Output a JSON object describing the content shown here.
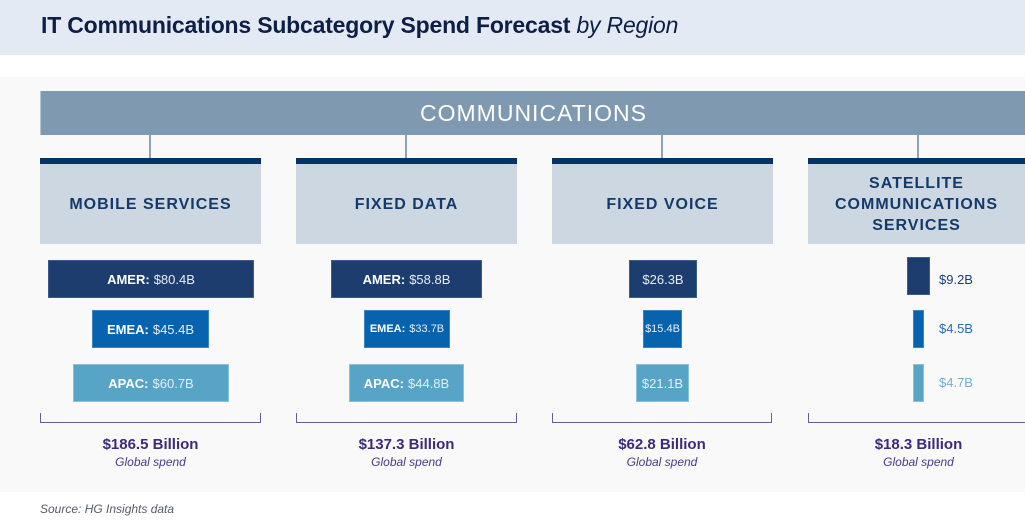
{
  "header": {
    "title_main": "IT Communications Subcategory Spend Forecast",
    "title_sub": "by Region"
  },
  "root": {
    "label": "COMMUNICATIONS"
  },
  "categories": [
    {
      "name": "MOBILE SERVICES",
      "regions": [
        {
          "region": "AMER:",
          "value": "$80.4B",
          "amount": 80.4
        },
        {
          "region": "EMEA:",
          "value": "$45.4B",
          "amount": 45.4
        },
        {
          "region": "APAC:",
          "value": "$60.7B",
          "amount": 60.7
        }
      ],
      "total": "$186.5 Billion",
      "total_label": "Global spend"
    },
    {
      "name": "FIXED DATA",
      "regions": [
        {
          "region": "AMER:",
          "value": "$58.8B",
          "amount": 58.8
        },
        {
          "region": "EMEA:",
          "value": "$33.7B",
          "amount": 33.7
        },
        {
          "region": "APAC:",
          "value": "$44.8B",
          "amount": 44.8
        }
      ],
      "total": "$137.3 Billion",
      "total_label": "Global spend"
    },
    {
      "name": "FIXED VOICE",
      "regions": [
        {
          "region": "",
          "value": "$26.3B",
          "amount": 26.3
        },
        {
          "region": "",
          "value": "$15.4B",
          "amount": 15.4
        },
        {
          "region": "",
          "value": "$21.1B",
          "amount": 21.1
        }
      ],
      "total": "$62.8 Billion",
      "total_label": "Global spend"
    },
    {
      "name": "SATELLITE COMMUNICATIONS SERVICES",
      "name_lines": [
        "SATELLITE",
        "COMMUNICATIONS",
        "SERVICES"
      ],
      "regions": [
        {
          "region": "",
          "value": "$9.2B",
          "amount": 9.2
        },
        {
          "region": "",
          "value": "$4.5B",
          "amount": 4.5
        },
        {
          "region": "",
          "value": "$4.7B",
          "amount": 4.7
        }
      ],
      "total": "$18.3 Billion",
      "total_label": "Global spend"
    }
  ],
  "colors": {
    "amer": "#1c3d6e",
    "emea": "#0763ae",
    "apac": "#58a4c6",
    "root_bar": "#7f99b1",
    "category_box": "#cdd7e2",
    "category_stripe": "#003366",
    "total_text": "#3e2a7a"
  },
  "footer": {
    "source": "Source: HG Insights data"
  }
}
